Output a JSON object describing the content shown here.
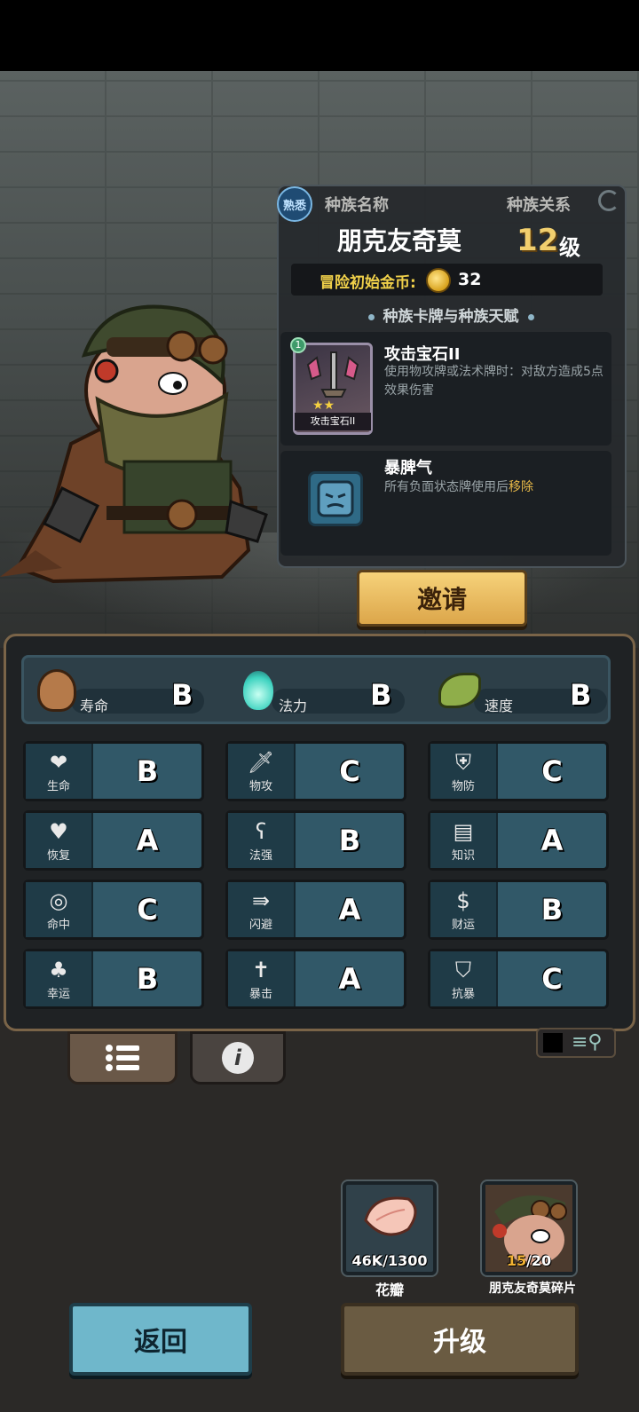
{
  "race": {
    "familiarity_badge": "熟悉",
    "name_header": "种族名称",
    "relation_header": "种族关系",
    "name": "朋克友奇莫",
    "level_number": "12",
    "level_suffix": "级",
    "gold_label": "冒险初始金币:",
    "gold_value": "32",
    "section_title": "种族卡牌与种族天赋"
  },
  "card": {
    "badge": "1",
    "caption": "攻击宝石II",
    "title": "攻击宝石II",
    "desc": "使用物攻牌或法术牌时：对敌方造成5点效果伤害"
  },
  "talent": {
    "title": "暴脾气",
    "desc_prefix": "所有负面状态牌使用后",
    "desc_highlight": "移除"
  },
  "invite_label": "邀请",
  "top_stats": [
    {
      "label": "寿命",
      "grade": "B",
      "icon": "acorn-icon"
    },
    {
      "label": "法力",
      "grade": "B",
      "icon": "flame-icon"
    },
    {
      "label": "速度",
      "grade": "B",
      "icon": "wing-icon"
    }
  ],
  "stats": [
    {
      "label": "生命",
      "grade": "B",
      "icon": "heart-icon"
    },
    {
      "label": "物攻",
      "grade": "C",
      "icon": "sword-icon"
    },
    {
      "label": "物防",
      "grade": "C",
      "icon": "armor-icon"
    },
    {
      "label": "恢复",
      "grade": "A",
      "icon": "heart-plus-icon"
    },
    {
      "label": "法强",
      "grade": "B",
      "icon": "staff-icon"
    },
    {
      "label": "知识",
      "grade": "A",
      "icon": "book-icon"
    },
    {
      "label": "命中",
      "grade": "C",
      "icon": "target-icon"
    },
    {
      "label": "闪避",
      "grade": "A",
      "icon": "dodge-icon"
    },
    {
      "label": "财运",
      "grade": "B",
      "icon": "coin-icon"
    },
    {
      "label": "幸运",
      "grade": "B",
      "icon": "clover-icon"
    },
    {
      "label": "暴击",
      "grade": "A",
      "icon": "crit-icon"
    },
    {
      "label": "抗暴",
      "grade": "C",
      "icon": "shield-icon"
    }
  ],
  "items": [
    {
      "count": "46K/1300",
      "name": "花瓣",
      "count_color": "#ffffff"
    },
    {
      "count_have": "15",
      "count_need": "/20",
      "name": "朋克友奇莫碎片",
      "count_color": "#f2b233"
    }
  ],
  "buttons": {
    "back": "返回",
    "upgrade": "升级"
  }
}
